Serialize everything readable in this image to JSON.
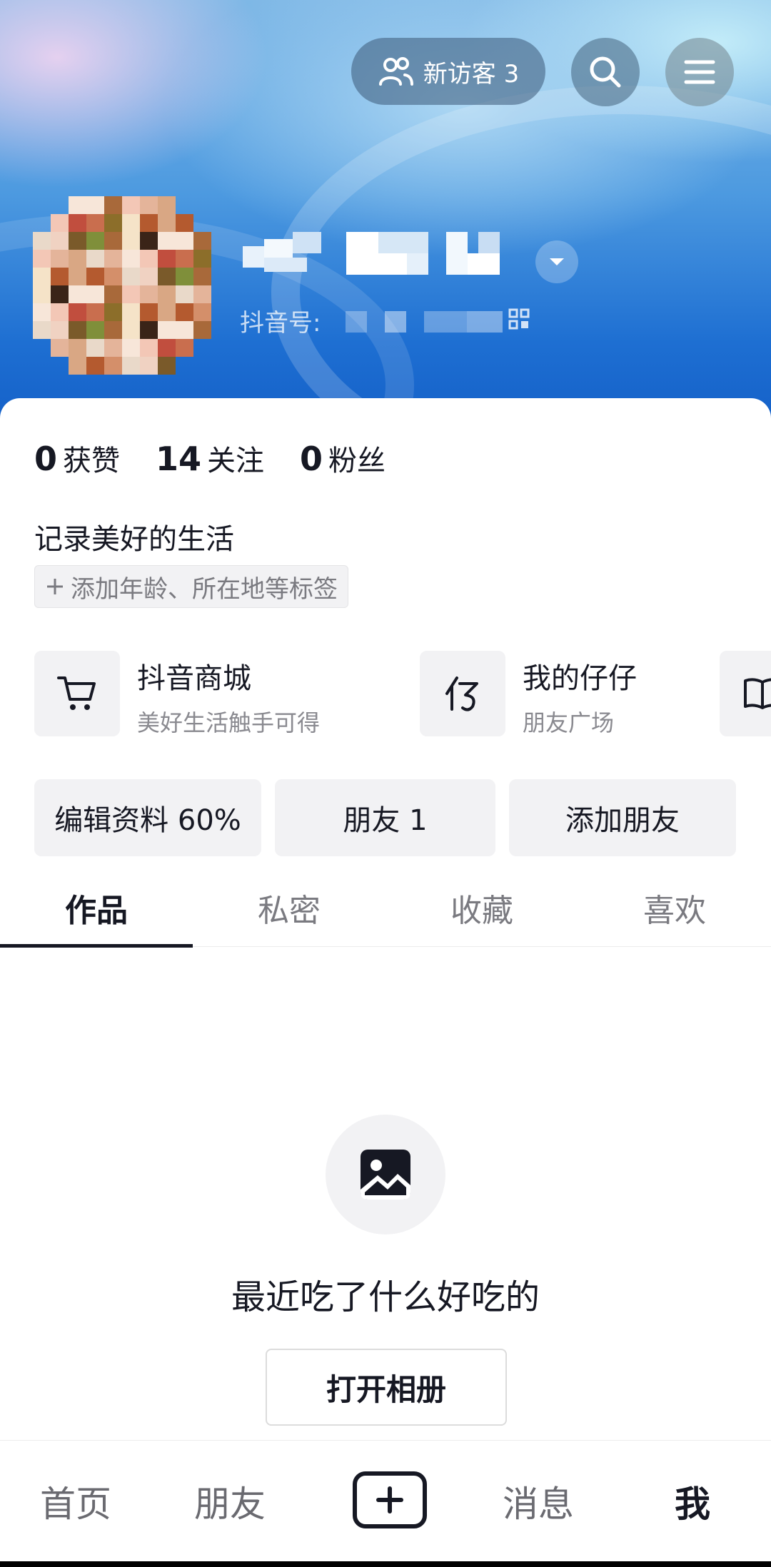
{
  "header": {
    "visitors_label": "新访客 3",
    "douyin_id_label": "抖音号:"
  },
  "stats": [
    {
      "count": "0",
      "label": "获赞"
    },
    {
      "count": "14",
      "label": "关注"
    },
    {
      "count": "0",
      "label": "粉丝"
    }
  ],
  "profile": {
    "bio": "记录美好的生活",
    "tag_chip": "添加年龄、所在地等标签"
  },
  "services": [
    {
      "title": "抖音商城",
      "subtitle": "美好生活触手可得",
      "icon": "cart-icon"
    },
    {
      "title": "我的仔仔",
      "subtitle": "朋友广场",
      "icon": "zaizai-icon"
    },
    {
      "title": "",
      "subtitle": "",
      "icon": "book-icon"
    }
  ],
  "actions": {
    "edit_profile": "编辑资料 60%",
    "friends": "朋友 1",
    "add_friends": "添加朋友"
  },
  "tabs": [
    {
      "label": "作品",
      "active": true
    },
    {
      "label": "私密",
      "active": false
    },
    {
      "label": "收藏",
      "active": false
    },
    {
      "label": "喜欢",
      "active": false
    }
  ],
  "empty_state": {
    "icon": "image-icon",
    "message": "最近吃了什么好吃的",
    "button_label": "打开相册"
  },
  "bottom_nav": [
    {
      "label": "首页",
      "active": false
    },
    {
      "label": "朋友",
      "active": false
    },
    {
      "label": "",
      "icon": "plus-icon"
    },
    {
      "label": "消息",
      "active": false
    },
    {
      "label": "我",
      "active": true
    }
  ]
}
